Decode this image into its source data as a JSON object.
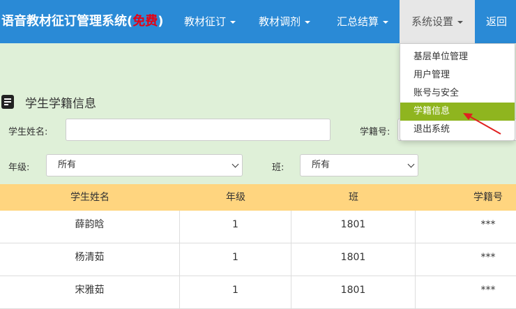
{
  "navbar": {
    "brand_main": "语音教材征订管理系统(",
    "brand_free": "免费",
    "brand_end": ")",
    "items": [
      {
        "label": "教材征订"
      },
      {
        "label": "教材调剂"
      },
      {
        "label": "汇总结算"
      },
      {
        "label": "系统设置"
      },
      {
        "label": "返回"
      }
    ]
  },
  "dropdown": {
    "items": [
      {
        "label": "基层单位管理"
      },
      {
        "label": "用户管理"
      },
      {
        "label": "账号与安全"
      },
      {
        "label": "学籍信息"
      },
      {
        "label": "退出系统"
      }
    ],
    "selected": "学籍信息"
  },
  "page": {
    "title": "学生学籍信息"
  },
  "filters": {
    "student_name_label": "学生姓名:",
    "student_name_value": "",
    "student_id_label": "学籍号:",
    "grade_label": "年级:",
    "grade_value": "所有",
    "class_label": "班:",
    "class_value": "所有"
  },
  "table": {
    "headers": [
      "学生姓名",
      "年级",
      "班",
      "学籍号"
    ],
    "rows": [
      [
        "薛韵晗",
        "1",
        "1801",
        "***"
      ],
      [
        "杨清茹",
        "1",
        "1801",
        "***"
      ],
      [
        "宋雅茹",
        "1",
        "1801",
        "***"
      ]
    ]
  },
  "colors": {
    "navbar": "#2a8ad6",
    "content_bg": "#dff0d8",
    "table_header": "#ffd57f",
    "menu_highlight": "#8fb51f",
    "annotation_arrow": "#e02020"
  }
}
